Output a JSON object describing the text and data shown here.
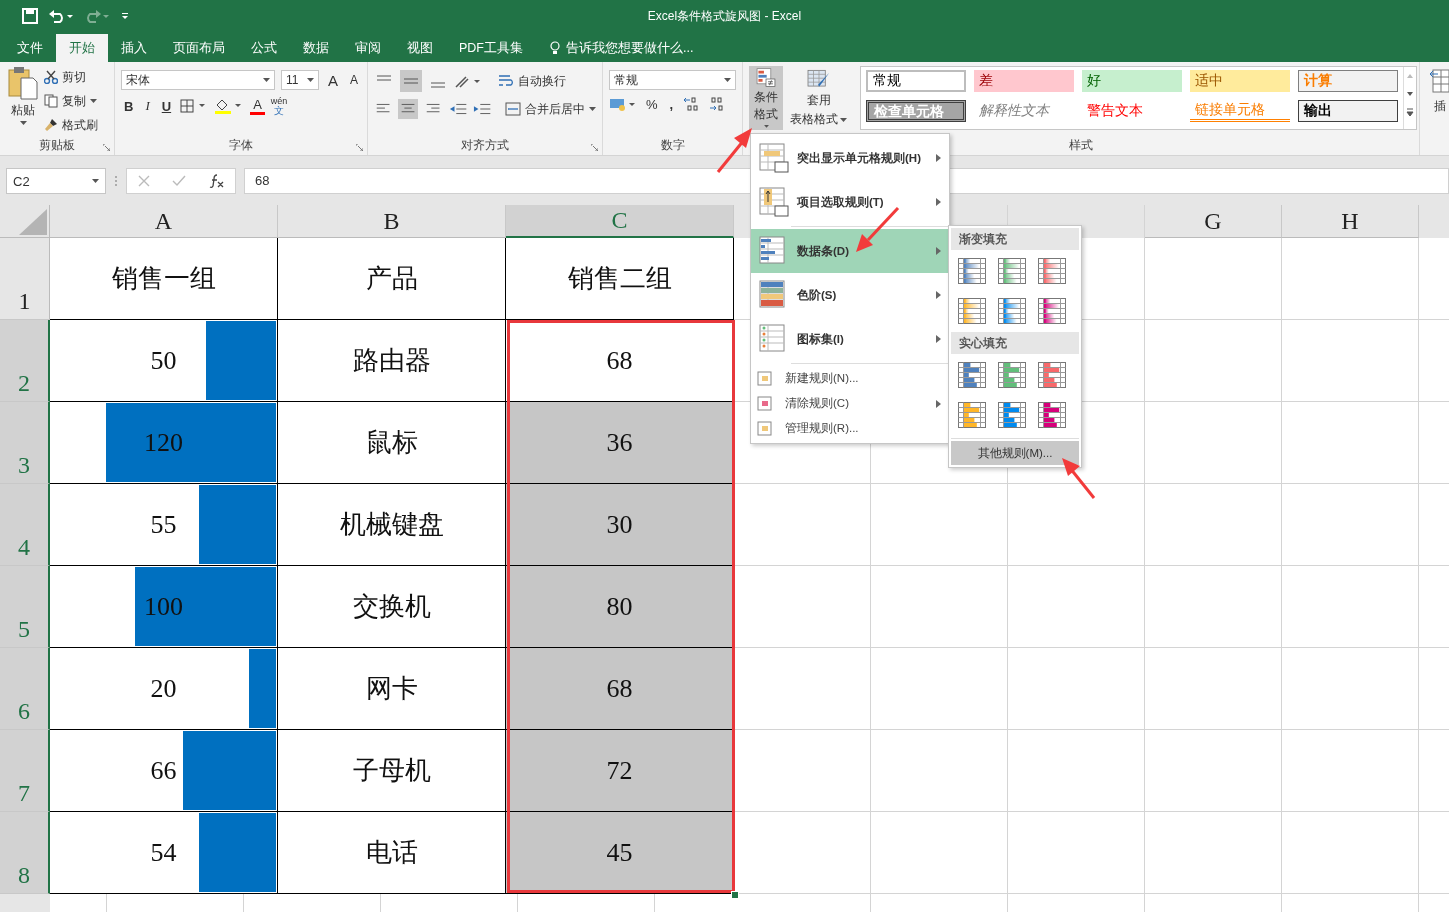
{
  "window": {
    "title": "Excel条件格式旋风图 - Excel"
  },
  "tabs": [
    {
      "label": "文件",
      "selected": false
    },
    {
      "label": "开始",
      "selected": true
    },
    {
      "label": "插入",
      "selected": false
    },
    {
      "label": "页面布局",
      "selected": false
    },
    {
      "label": "公式",
      "selected": false
    },
    {
      "label": "数据",
      "selected": false
    },
    {
      "label": "审阅",
      "selected": false
    },
    {
      "label": "视图",
      "selected": false
    },
    {
      "label": "PDF工具集",
      "selected": false
    }
  ],
  "tell_me": "告诉我您想要做什么...",
  "clipboard": {
    "paste": "粘贴",
    "cut": "剪切",
    "copy": "复制",
    "format_painter": "格式刷",
    "label": "剪贴板"
  },
  "font": {
    "name": "宋体",
    "size": "11",
    "grow": "A",
    "shrink": "A",
    "bold": "B",
    "italic": "I",
    "underline": "U",
    "font_color": "A",
    "phonetic_top": "wén",
    "phonetic_bottom": "文",
    "label": "字体"
  },
  "alignment": {
    "wrap": "自动换行",
    "merge": "合并后居中",
    "label": "对齐方式"
  },
  "number": {
    "format": "常规",
    "percent": "%",
    "comma": ",",
    "label": "数字"
  },
  "styles": {
    "conditional": "条件格式",
    "table_format_1": "套用",
    "table_format_2": "表格格式",
    "label": "样式",
    "cells": [
      {
        "label": "常规",
        "kind": "normal"
      },
      {
        "label": "差",
        "kind": "bad"
      },
      {
        "label": "好",
        "kind": "good"
      },
      {
        "label": "适中",
        "kind": "neutral"
      },
      {
        "label": "计算",
        "kind": "calculation"
      },
      {
        "label": "检查单元格",
        "kind": "check"
      },
      {
        "label": "解释性文本",
        "kind": "explanatory"
      },
      {
        "label": "警告文本",
        "kind": "warning"
      },
      {
        "label": "链接单元格",
        "kind": "linked"
      },
      {
        "label": "输出",
        "kind": "output"
      }
    ]
  },
  "cells_group": {
    "insert": "插"
  },
  "name_box": "C2",
  "formula": "68",
  "columns_left": [
    {
      "label": "A",
      "selected": false
    },
    {
      "label": "B",
      "selected": false
    },
    {
      "label": "C",
      "selected": true
    }
  ],
  "columns_right": [
    {
      "label": "G",
      "selected": false
    },
    {
      "label": "H",
      "selected": false
    }
  ],
  "row_numbers": [
    {
      "label": "1",
      "selected": false
    },
    {
      "label": "2",
      "selected": true
    },
    {
      "label": "3",
      "selected": true
    },
    {
      "label": "4",
      "selected": true
    },
    {
      "label": "5",
      "selected": true
    },
    {
      "label": "6",
      "selected": true
    },
    {
      "label": "7",
      "selected": true
    },
    {
      "label": "8",
      "selected": true
    }
  ],
  "header": {
    "a": "销售一组",
    "b": "产品",
    "c": "销售二组"
  },
  "rows": [
    {
      "a": "50",
      "level": 0.31,
      "b": "路由器",
      "c": "68",
      "selected": false
    },
    {
      "a": "120",
      "level": 0.75,
      "b": "鼠标",
      "c": "36",
      "selected": true
    },
    {
      "a": "55",
      "level": 0.34,
      "b": "机械键盘",
      "c": "30",
      "selected": true
    },
    {
      "a": "100",
      "level": 0.62,
      "b": "交换机",
      "c": "80",
      "selected": true
    },
    {
      "a": "20",
      "level": 0.12,
      "b": "网卡",
      "c": "68",
      "selected": true
    },
    {
      "a": "66",
      "level": 0.41,
      "b": "子母机",
      "c": "72",
      "selected": true
    },
    {
      "a": "54",
      "level": 0.34,
      "b": "电话",
      "c": "45",
      "selected": true
    }
  ],
  "menu": {
    "items": [
      {
        "label": "突出显示单元格规则(H)",
        "kind": "highlight",
        "submenu": true,
        "selected": false
      },
      {
        "label": "项目选取规则(T)",
        "kind": "topbottom",
        "submenu": true,
        "selected": false
      },
      {
        "label": "数据条(D)",
        "kind": "databar",
        "submenu": true,
        "selected": true
      },
      {
        "label": "色阶(S)",
        "kind": "colorscale",
        "submenu": true,
        "selected": false
      },
      {
        "label": "图标集(I)",
        "kind": "iconset",
        "submenu": true,
        "selected": false
      },
      {
        "label": "新建规则(N)...",
        "kind": "new",
        "submenu": false,
        "selected": false
      },
      {
        "label": "清除规则(C)",
        "kind": "clear",
        "submenu": true,
        "selected": false
      },
      {
        "label": "管理规则(R)...",
        "kind": "manage",
        "submenu": false,
        "selected": false
      }
    ]
  },
  "submenu": {
    "sections": [
      {
        "title": "渐变填充",
        "kind": "gradient",
        "options": [
          {
            "color": "#4f81bd"
          },
          {
            "color": "#63be7b"
          },
          {
            "color": "#f8696b"
          },
          {
            "color": "#ffb628"
          },
          {
            "color": "#008aef"
          },
          {
            "color": "#d6007b"
          }
        ]
      },
      {
        "title": "实心填充",
        "kind": "solid",
        "options": [
          {
            "color": "#4f81bd"
          },
          {
            "color": "#63be7b"
          },
          {
            "color": "#f8696b"
          },
          {
            "color": "#ffb628"
          },
          {
            "color": "#008aef"
          },
          {
            "color": "#d6007b"
          }
        ]
      }
    ],
    "more": "其他规则(M)..."
  }
}
